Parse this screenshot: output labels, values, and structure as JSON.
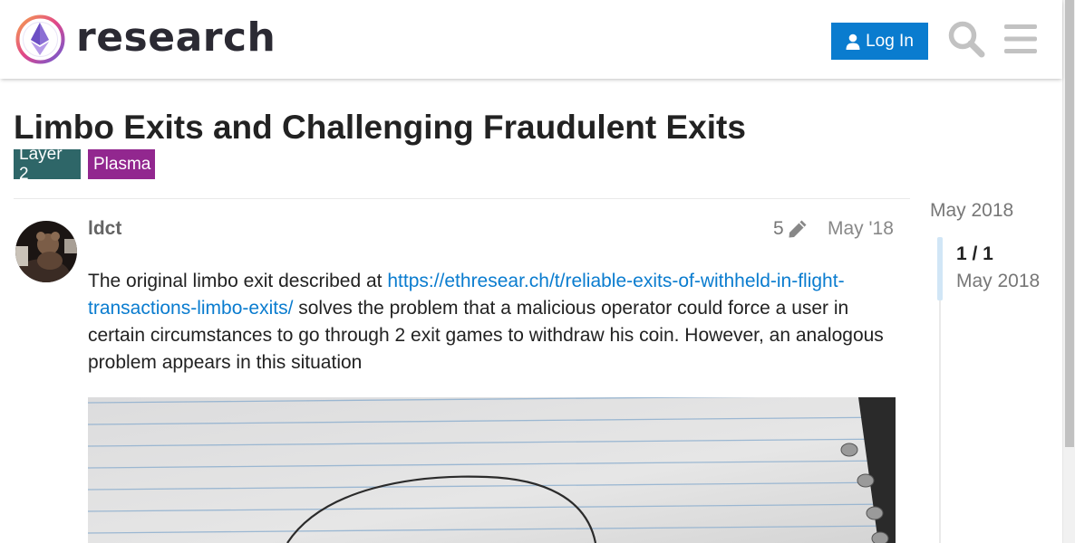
{
  "header": {
    "site_name": "research",
    "login_label": "Log In",
    "search_icon": "search-icon",
    "menu_icon": "hamburger-menu-icon",
    "accent_color": "#0a7ccf"
  },
  "topic": {
    "title": "Limbo Exits and Challenging Fraudulent Exits",
    "tags": [
      {
        "label": "Layer 2",
        "color": "#2e6668"
      },
      {
        "label": "Plasma",
        "color": "#92278f"
      }
    ]
  },
  "post": {
    "username": "ldct",
    "edit_count": "5",
    "date": "May '18",
    "body_prefix": "The original limbo exit described at ",
    "link_text": "https://ethresear.ch/t/reliable-exits-of-withheld-in-flight-transactions-limbo-exits/",
    "body_suffix": " solves the problem that a malicious operator could force a user in certain circumstances to go through 2 exit games to withdraw his coin. However, an analogous problem appears in this situation"
  },
  "timeline": {
    "start_date": "May 2018",
    "position": "1 / 1",
    "current_date": "May 2018"
  }
}
